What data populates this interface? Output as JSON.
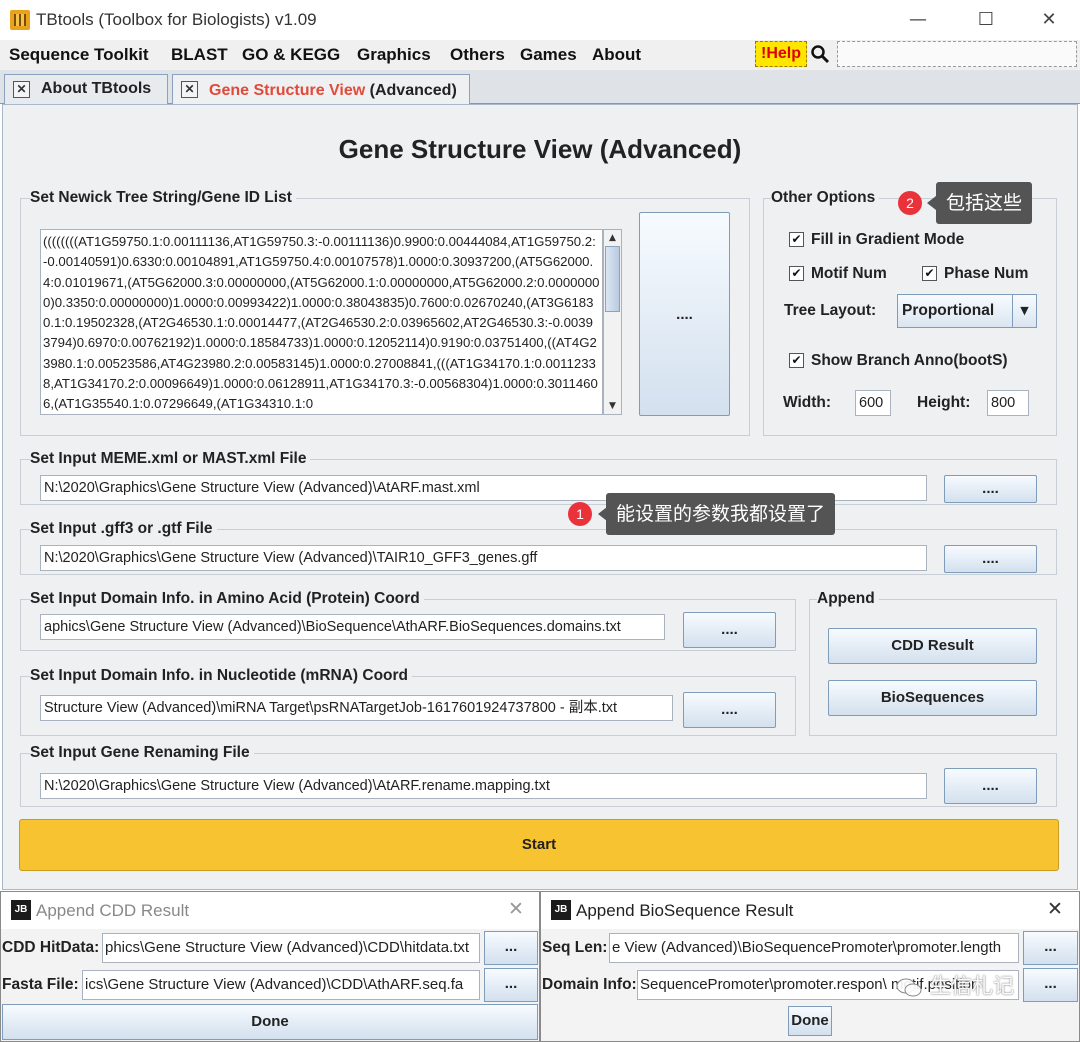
{
  "window": {
    "title": "TBtools (Toolbox for Biologists) v1.09",
    "controls": {
      "minimize": "—",
      "maximize": "☐",
      "close": "✕"
    }
  },
  "menubar": {
    "items": [
      "Sequence Toolkit",
      "BLAST",
      "GO & KEGG",
      "Graphics",
      "Others",
      "Games",
      "About"
    ],
    "help_label": "!Help"
  },
  "tabs": [
    {
      "label": "About TBtools",
      "active": false
    },
    {
      "label_part1": "Gene Structure View",
      "label_part2": " (Advanced)",
      "active": true
    }
  ],
  "page_title": "Gene Structure View (Advanced)",
  "tree_panel": {
    "label": "Set Newick Tree String/Gene ID List",
    "text": "((((((((AT1G59750.1:0.00111136,AT1G59750.3:-0.00111136)0.9900:0.00444084,AT1G59750.2:-0.00140591)0.6330:0.00104891,AT1G59750.4:0.00107578)1.0000:0.30937200,(AT5G62000.4:0.01019671,(AT5G62000.3:0.00000000,(AT5G62000.1:0.00000000,AT5G62000.2:0.00000000)0.3350:0.00000000)1.0000:0.00993422)1.0000:0.38043835)0.7600:0.02670240,(AT3G61830.1:0.19502328,(AT2G46530.1:0.00014477,(AT2G46530.2:0.03965602,AT2G46530.3:-0.00393794)0.6970:0.00762192)1.0000:0.18584733)1.0000:0.12052114)0.9190:0.03751400,((AT4G23980.1:0.00523586,AT4G23980.2:0.00583145)1.0000:0.27008841,(((AT1G34170.1:0.00112338,AT1G34170.2:0.00096649)1.0000:0.06128911,AT1G34170.3:-0.00568304)1.0000:0.30114606,(AT1G35540.1:0.07296649,(AT1G34310.1:0",
    "browse_label": "...."
  },
  "other_options": {
    "label": "Other Options",
    "fill_gradient": "Fill in Gradient Mode",
    "motif_num": "Motif Num",
    "phase_num": "Phase Num",
    "tree_layout_label": "Tree Layout:",
    "tree_layout_value": "Proportional",
    "show_branch": "Show Branch Anno(bootS)",
    "width_label": "Width:",
    "width_value": "600",
    "height_label": "Height:",
    "height_value": "800",
    "check_mark": "✔"
  },
  "meme": {
    "label": "Set Input MEME.xml or MAST.xml File",
    "value": "N:\\2020\\Graphics\\Gene Structure View (Advanced)\\AtARF.mast.xml",
    "browse_label": "...."
  },
  "gff": {
    "label": "Set Input .gff3 or .gtf File",
    "value": "N:\\2020\\Graphics\\Gene Structure View (Advanced)\\TAIR10_GFF3_genes.gff",
    "browse_label": "...."
  },
  "domain_aa": {
    "label": "Set Input Domain Info. in Amino Acid (Protein) Coord",
    "value": "aphics\\Gene Structure View (Advanced)\\BioSequence\\AthARF.BioSequences.domains.txt",
    "browse_label": "...."
  },
  "domain_nt": {
    "label": "Set Input Domain Info. in Nucleotide (mRNA) Coord",
    "value": "Structure View (Advanced)\\miRNA Target\\psRNATargetJob-1617601924737800 - 副本.txt",
    "browse_label": "...."
  },
  "append": {
    "label": "Append",
    "cdd_button": "CDD Result",
    "bioseq_button": "BioSequences"
  },
  "rename": {
    "label": "Set Input Gene Renaming File",
    "value": "N:\\2020\\Graphics\\Gene Structure View (Advanced)\\AtARF.rename.mapping.txt",
    "browse_label": "...."
  },
  "start_label": "Start",
  "callouts": [
    {
      "num": "1",
      "text": "能设置的参数我都设置了"
    },
    {
      "num": "2",
      "text": "包括这些"
    }
  ],
  "cdd_dialog": {
    "icon": "JB",
    "title": "Append CDD Result",
    "hitdata_label": "CDD HitData:",
    "hitdata_value": "phics\\Gene Structure View (Advanced)\\CDD\\hitdata.txt",
    "fasta_label": "Fasta File:",
    "fasta_value": "ics\\Gene Structure View (Advanced)\\CDD\\AthARF.seq.fa",
    "browse_label": "...",
    "done_label": "Done",
    "close": "✕"
  },
  "bioseq_dialog": {
    "icon": "JB",
    "title": "Append BioSequence Result",
    "seqlen_label": "Seq Len:",
    "seqlen_value": "e View (Advanced)\\BioSequencePromoter\\promoter.length",
    "domain_label": "Domain Info:",
    "domain_value": "SequencePromoter\\promoter.respon\\ motif.position",
    "browse_label": "...",
    "done_label": "Done",
    "close": "✕"
  },
  "watermark": "生信札记",
  "colors": {
    "accent_yellow": "#f8c331",
    "help_yellow": "#ffe600",
    "active_tab_red": "#e04a3a",
    "callout_red": "#e9323a"
  }
}
